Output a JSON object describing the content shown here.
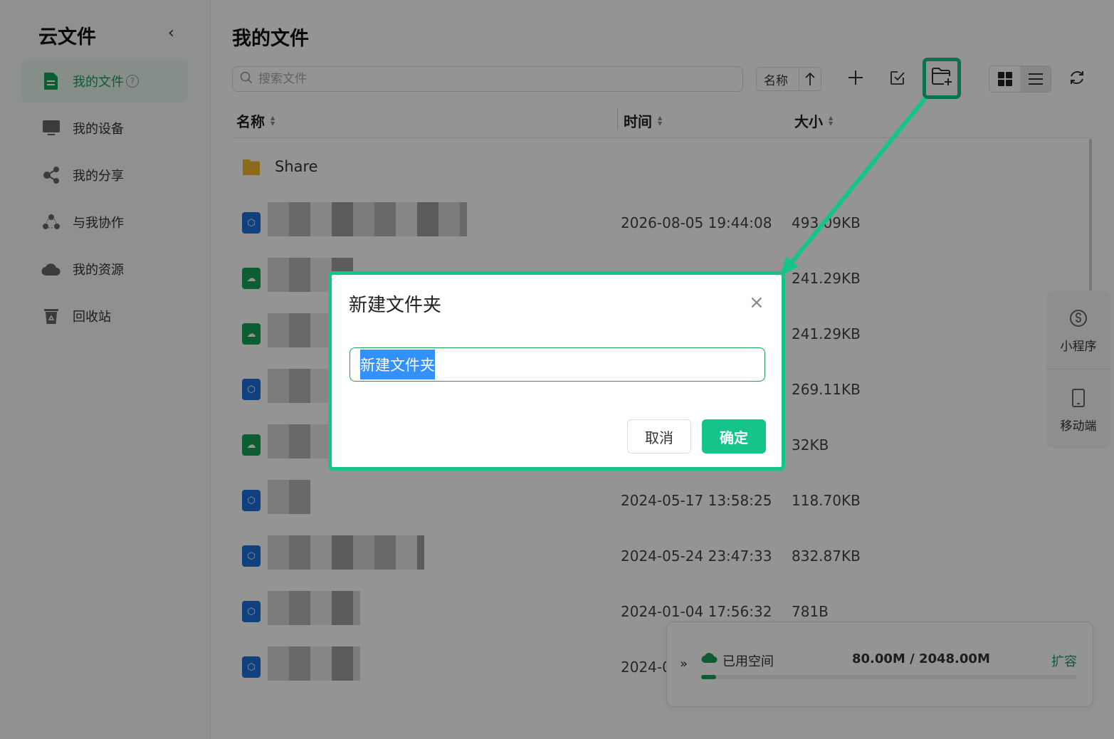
{
  "sidebar": {
    "title": "云文件",
    "items": [
      {
        "label": "我的文件",
        "active": true
      },
      {
        "label": "我的设备"
      },
      {
        "label": "我的分享"
      },
      {
        "label": "与我协作"
      },
      {
        "label": "我的资源"
      },
      {
        "label": "回收站"
      }
    ]
  },
  "main": {
    "title": "我的文件",
    "search_placeholder": "搜索文件",
    "sort_label": "名称",
    "columns": {
      "name": "名称",
      "time": "时间",
      "size": "大小"
    },
    "rows": [
      {
        "name": "Share",
        "type": "folder",
        "time": "",
        "size": ""
      },
      {
        "name": "",
        "type": "doc-blue",
        "time": "2026-08-05 19:44:08",
        "size": "493.09KB"
      },
      {
        "name": "",
        "type": "doc-green",
        "time": "",
        "size": "241.29KB"
      },
      {
        "name": "",
        "type": "doc-green",
        "time": "",
        "size": "241.29KB"
      },
      {
        "name": "",
        "type": "doc-blue",
        "time": "",
        "size": "269.11KB"
      },
      {
        "name": "",
        "type": "doc-green",
        "time": "",
        "size": "32KB"
      },
      {
        "name": "",
        "type": "doc-blue",
        "time": "2024-05-17 13:58:25",
        "size": "118.70KB"
      },
      {
        "name": "",
        "type": "doc-blue",
        "time": "2024-05-24 23:47:33",
        "size": "832.87KB"
      },
      {
        "name": "",
        "type": "doc-blue",
        "time": "2024-01-04 17:56:32",
        "size": "781B"
      },
      {
        "name": "",
        "type": "doc-blue",
        "time": "2024-0",
        "size": ""
      }
    ]
  },
  "float_panel": {
    "mini_program": "小程序",
    "mobile": "移动端"
  },
  "storage": {
    "label": "已用空间",
    "value": "80.00M / 2048.00M",
    "expand": "扩容",
    "used_fraction": 0.039
  },
  "dialog": {
    "title": "新建文件夹",
    "input_value": "新建文件夹",
    "cancel": "取消",
    "confirm": "确定"
  },
  "colors": {
    "accent": "#14c48a",
    "brand_green": "#18a058",
    "selection": "#3390ff"
  }
}
